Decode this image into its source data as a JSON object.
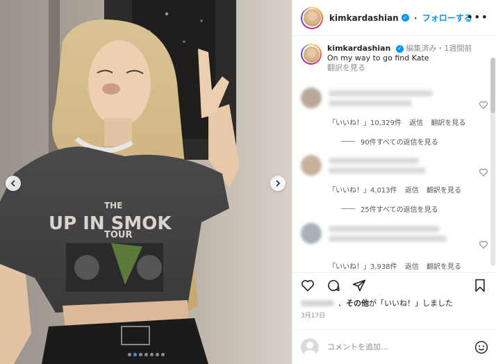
{
  "post": {
    "username": "kimkardashian",
    "follow_label": "フォローする",
    "header_separator": "・",
    "more_label": "•••",
    "media_count_current": 1,
    "media_count_total": 7
  },
  "caption": {
    "username": "kimkardashian",
    "edited": "編集済み",
    "separator": "・",
    "time_ago": "1週間前",
    "text": "On my way to go find Kate",
    "translate": "翻訳を見る"
  },
  "comments": [
    {
      "likes": "「いいね！」10,329件",
      "reply": "返信",
      "translate": "翻訳を見る",
      "view_replies": "90件すべての返信を見る"
    },
    {
      "likes": "「いいね！」4,013件",
      "reply": "返信",
      "translate": "翻訳を見る",
      "view_replies": "25件すべての返信を見る"
    },
    {
      "likes": "「いいね！」3,938件",
      "reply": "返信",
      "translate": "翻訳を見る"
    }
  ],
  "likes_line": {
    "prefix": "、",
    "bold": "その他",
    "suffix": "が「いいね！」しました"
  },
  "date": "3月17日",
  "composer": {
    "placeholder": "コメントを追加..."
  },
  "colors": {
    "accent": "#0095f6",
    "active_dot": "#3797f0",
    "muted": "#8e8e8e"
  },
  "icons": [
    "chevron-left-icon",
    "chevron-right-icon",
    "verified-icon",
    "more-icon",
    "heart-icon",
    "comment-icon",
    "share-icon",
    "bookmark-icon",
    "emoji-icon"
  ]
}
